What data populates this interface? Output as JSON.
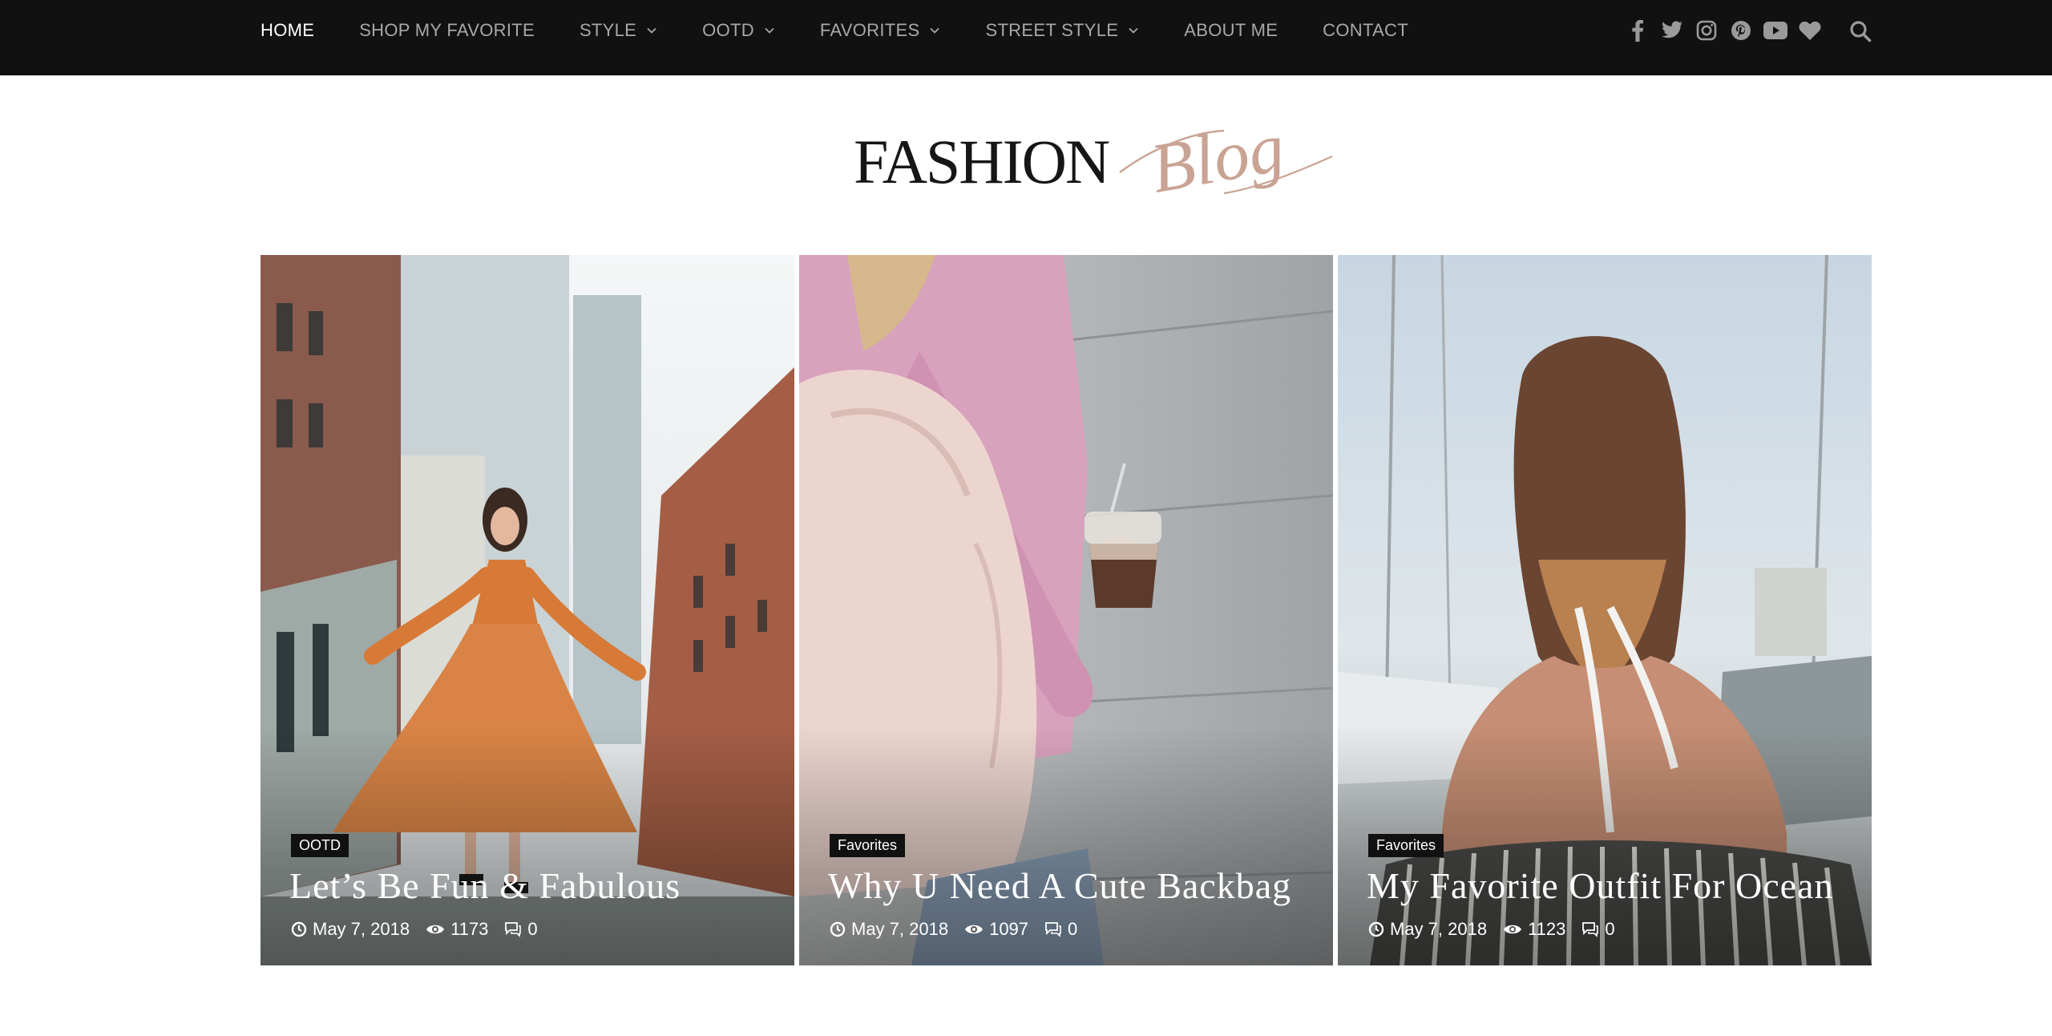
{
  "nav": {
    "items": [
      {
        "label": "HOME",
        "active": true,
        "dropdown": false
      },
      {
        "label": "SHOP MY FAVORITE",
        "active": false,
        "dropdown": false
      },
      {
        "label": "STYLE",
        "active": false,
        "dropdown": true
      },
      {
        "label": "OOTD",
        "active": false,
        "dropdown": true
      },
      {
        "label": "FAVORITES",
        "active": false,
        "dropdown": true
      },
      {
        "label": "STREET STYLE",
        "active": false,
        "dropdown": true
      },
      {
        "label": "ABOUT ME",
        "active": false,
        "dropdown": false
      },
      {
        "label": "CONTACT",
        "active": false,
        "dropdown": false
      }
    ],
    "social_icons": [
      "facebook-icon",
      "twitter-icon",
      "instagram-icon",
      "pinterest-icon",
      "youtube-icon",
      "heart-icon"
    ],
    "search_icon": "search-icon"
  },
  "logo": {
    "main": "FASHION",
    "script": "Blog"
  },
  "posts": [
    {
      "category": "OOTD",
      "title": "Let’s Be Fun & Fabulous",
      "date": "May 7, 2018",
      "views": "1173",
      "comments": "0"
    },
    {
      "category": "Favorites",
      "title": "Why U Need A Cute Backbag",
      "date": "May 7, 2018",
      "views": "1097",
      "comments": "0"
    },
    {
      "category": "Favorites",
      "title": "My Favorite Outfit For Ocean",
      "date": "May 7, 2018",
      "views": "1123",
      "comments": "0"
    }
  ],
  "colors": {
    "topbar": "#111111",
    "nav_text": "#a8a8a8",
    "nav_active": "#ffffff",
    "logo_script": "#c9a394"
  }
}
